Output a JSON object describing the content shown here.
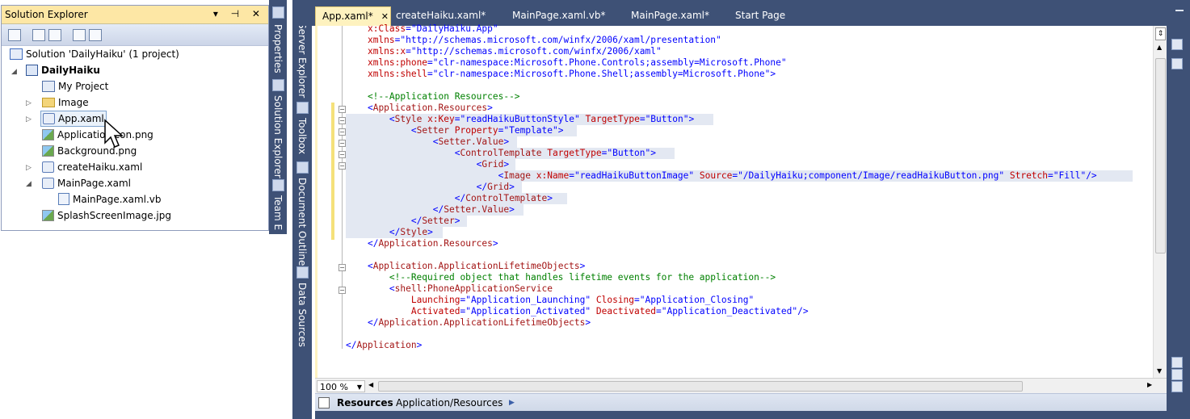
{
  "solution_explorer": {
    "title": "Solution Explorer",
    "title_buttons": "▾ ⊣ ✕",
    "tree": [
      {
        "label": "Solution 'DailyHaiku' (1 project)",
        "icon": "solution-icon"
      },
      {
        "label": "DailyHaiku",
        "icon": "project-icon"
      },
      {
        "label": "My Project",
        "icon": "my-project-icon"
      },
      {
        "label": "Image",
        "icon": "folder-icon"
      },
      {
        "label": "App.xaml",
        "icon": "xaml-file-icon"
      },
      {
        "label": "ApplicationIcon.png",
        "icon": "image-file-icon"
      },
      {
        "label": "Background.png",
        "icon": "image-file-icon"
      },
      {
        "label": "createHaiku.xaml",
        "icon": "xaml-file-icon"
      },
      {
        "label": "MainPage.xaml",
        "icon": "xaml-file-icon"
      },
      {
        "label": "MainPage.xaml.vb",
        "icon": "vb-file-icon"
      },
      {
        "label": "SplashScreenImage.jpg",
        "icon": "image-file-icon"
      }
    ]
  },
  "left_strip": {
    "tabs": [
      "Properties",
      "Solution Explorer",
      "Team E"
    ]
  },
  "middle_strip": {
    "tabs": [
      "Server Explorer",
      "Toolbox",
      "Document Outline",
      "Data Sources"
    ]
  },
  "document_tabs": [
    {
      "label": "App.xaml*",
      "active": true
    },
    {
      "label": "createHaiku.xaml*",
      "active": false
    },
    {
      "label": "MainPage.xaml.vb*",
      "active": false
    },
    {
      "label": "MainPage.xaml*",
      "active": false
    },
    {
      "label": "Start Page",
      "active": false
    }
  ],
  "code_lines": [
    "    x:Class=\"DailyHaiku.App\"",
    "    xmlns=\"http://schemas.microsoft.com/winfx/2006/xaml/presentation\"",
    "    xmlns:x=\"http://schemas.microsoft.com/winfx/2006/xaml\"",
    "    xmlns:phone=\"clr-namespace:Microsoft.Phone.Controls;assembly=Microsoft.Phone\"",
    "    xmlns:shell=\"clr-namespace:Microsoft.Phone.Shell;assembly=Microsoft.Phone\">",
    "",
    "    <!--Application Resources-->",
    "    <Application.Resources>",
    "        <Style x:Key=\"readHaikuButtonStyle\" TargetType=\"Button\">",
    "            <Setter Property=\"Template\">",
    "                <Setter.Value>",
    "                    <ControlTemplate TargetType=\"Button\">",
    "                        <Grid>",
    "                            <Image x:Name=\"readHaikuButtonImage\" Source=\"/DailyHaiku;component/Image/readHaikuButton.png\" Stretch=\"Fill\"/>",
    "                        </Grid>",
    "                    </ControlTemplate>",
    "                </Setter.Value>",
    "            </Setter>",
    "        </Style>",
    "    </Application.Resources>",
    "",
    "    <Application.ApplicationLifetimeObjects>",
    "        <!--Required object that handles lifetime events for the application-->",
    "        <shell:PhoneApplicationService",
    "            Launching=\"Application_Launching\" Closing=\"Application_Closing\"",
    "            Activated=\"Application_Activated\" Deactivated=\"Application_Deactivated\"/>",
    "    </Application.ApplicationLifetimeObjects>",
    "",
    "</Application>"
  ],
  "zoom": "100 %",
  "breadcrumb": {
    "first": "Resources",
    "second": "Application/Resources"
  },
  "colors": {
    "chrome": "#3e5176",
    "active_tab": "#fef2bf",
    "selection": "#e3e8f2",
    "se_title": "#fde7a5"
  }
}
